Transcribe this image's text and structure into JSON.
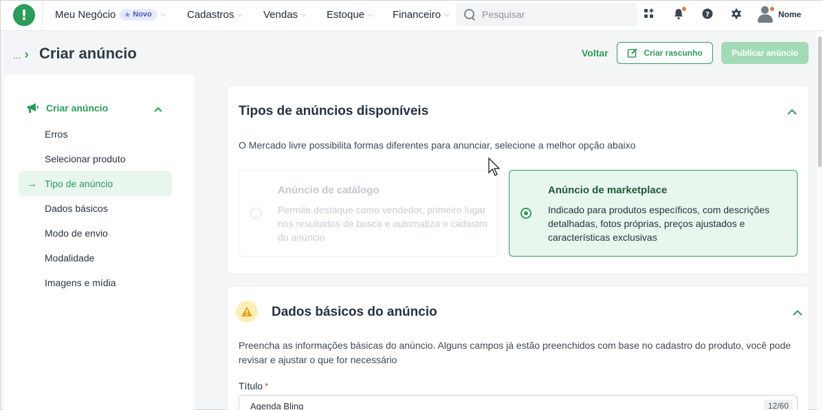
{
  "topnav": {
    "brand_letter": "!",
    "items": [
      {
        "label": "Meu Negócio",
        "badge": "Novo"
      },
      {
        "label": "Cadastros"
      },
      {
        "label": "Vendas"
      },
      {
        "label": "Estoque"
      },
      {
        "label": "Financeiro"
      }
    ],
    "search_placeholder": "Pesquisar",
    "icons": [
      "apps-grid-icon",
      "bell-icon",
      "help-icon",
      "gear-icon"
    ],
    "user_name": "Nome",
    "accent": "#2d9b5a",
    "notify_color": "#e5773a"
  },
  "header": {
    "breadcrumb_ellipsis": "...",
    "title": "Criar anúncio",
    "back_label": "Voltar",
    "draft_label": "Criar rascunho",
    "publish_label": "Publicar anúncio"
  },
  "sidebar": {
    "section_label": "Criar anúncio",
    "items": [
      {
        "label": "Erros"
      },
      {
        "label": "Selecionar produto"
      },
      {
        "label": "Tipo de anúncio",
        "active": true
      },
      {
        "label": "Dados básicos"
      },
      {
        "label": "Modo de envio"
      },
      {
        "label": "Modalidade"
      },
      {
        "label": "Imagens e mídia"
      }
    ]
  },
  "ad_types": {
    "title": "Tipos de anúncios disponíveis",
    "description": "O Mercado livre possibilita formas diferentes para anunciar, selecione a melhor opção abaixo",
    "options": [
      {
        "title": "Anúncio de catálogo",
        "text": "Permite destaque como vendedor, primeiro lugar nos resultados de busca e automatiza o cadastro do anúncio",
        "selected": false,
        "disabled": true
      },
      {
        "title": "Anúncio de marketplace",
        "text": "Indicado para produtos específicos, com descrições detalhadas, fotos próprias, preços ajustados e características exclusivas",
        "selected": true
      }
    ]
  },
  "basic_data": {
    "title": "Dados básicos do anúncio",
    "description": "Preencha as informações básicas do anúncio. Alguns campos já estão preenchidos com base no cadastro do produto, você pode revisar e ajustar o que for necessário",
    "title_field": {
      "label": "Título",
      "required_mark": "*",
      "value": "Agenda Bling",
      "counter": "12/60"
    },
    "warning_color": "#f0b429"
  }
}
